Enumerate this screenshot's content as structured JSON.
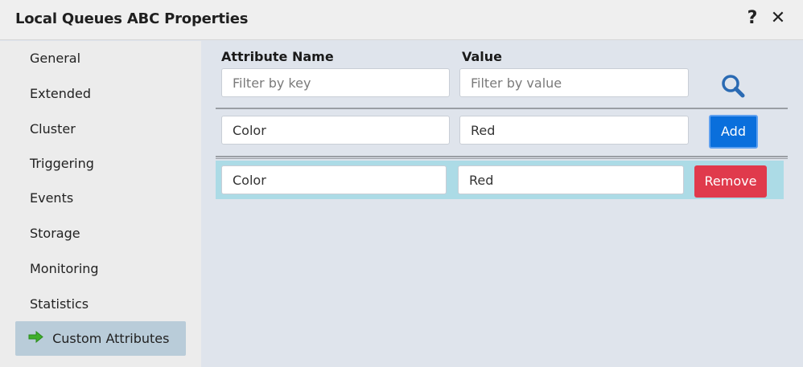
{
  "window": {
    "title": "Local Queues ABC Properties",
    "help_label": "?",
    "close_label": "✕"
  },
  "sidebar": {
    "items": [
      {
        "label": "General"
      },
      {
        "label": "Extended"
      },
      {
        "label": "Cluster"
      },
      {
        "label": "Triggering"
      },
      {
        "label": "Events"
      },
      {
        "label": "Storage"
      },
      {
        "label": "Monitoring"
      },
      {
        "label": "Statistics"
      },
      {
        "label": "Custom Attributes",
        "active": true,
        "icon": "arrow-right-icon"
      }
    ]
  },
  "attributes": {
    "header_name": "Attribute Name",
    "header_value": "Value",
    "filter_key_placeholder": "Filter by key",
    "filter_value_placeholder": "Filter by value",
    "search_icon": "search-icon",
    "new_name": "Color",
    "new_value": "Red",
    "add_label": "Add",
    "rows": [
      {
        "name": "Color",
        "value": "Red",
        "remove_label": "Remove"
      }
    ]
  },
  "colors": {
    "accent": "#0a6fdc",
    "danger": "#e03a4c",
    "row_highlight": "#acdbe6",
    "active_nav": "#b9ccd9"
  }
}
